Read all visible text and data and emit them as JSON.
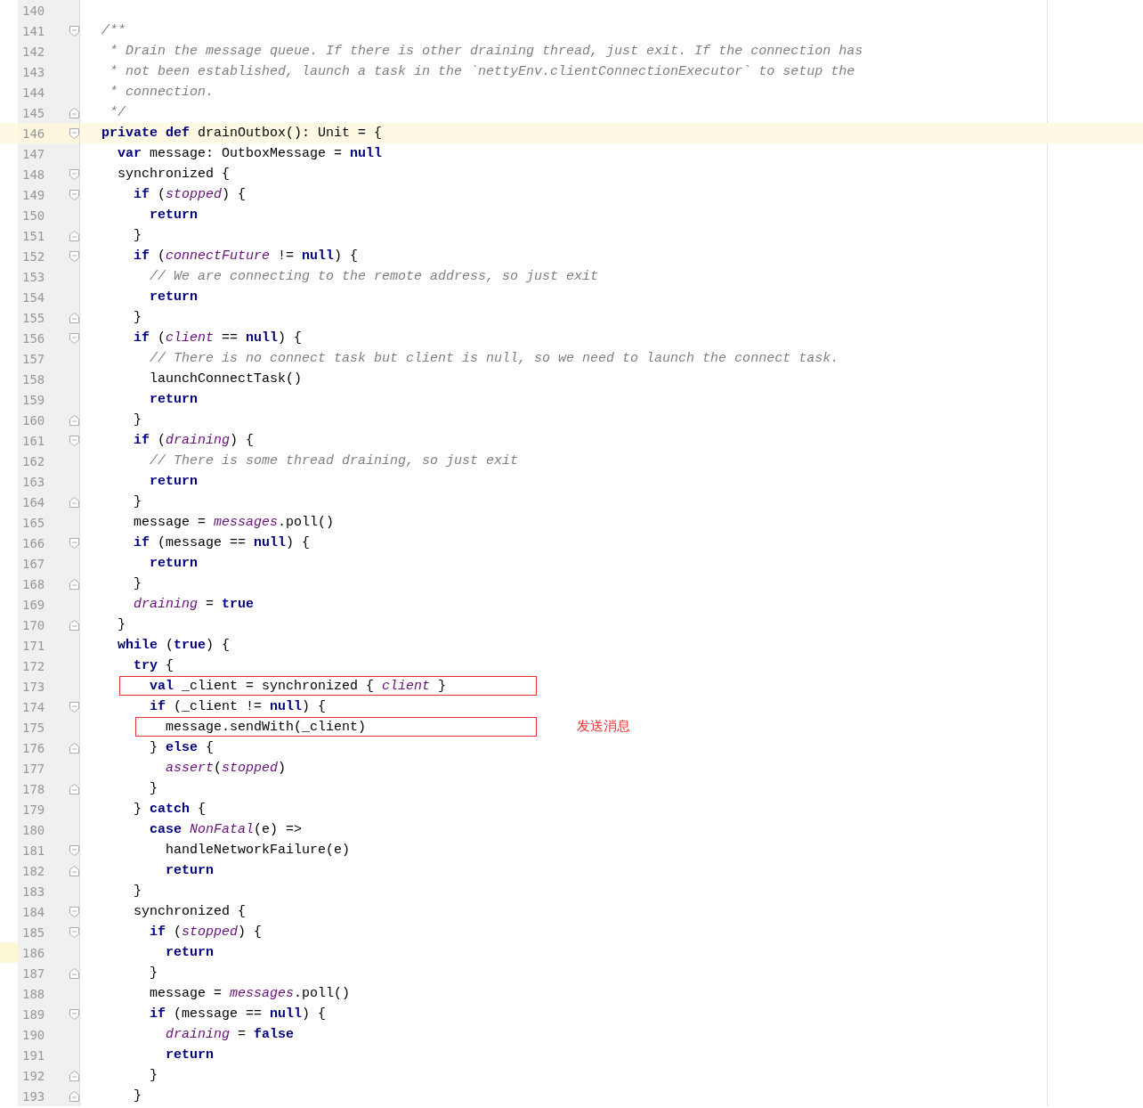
{
  "lines": [
    {
      "number": "140"
    },
    {
      "number": "141",
      "kind": "comment",
      "fold_start": true,
      "text": "/**"
    },
    {
      "number": "142",
      "kind": "comment",
      "text": " * Drain the message queue. If there is other draining thread, just exit. If the connection has"
    },
    {
      "number": "143",
      "kind": "comment",
      "text": " * not been established, launch a task in the `nettyEnv.clientConnectionExecutor` to setup the"
    },
    {
      "number": "144",
      "kind": "comment",
      "text": " * connection."
    },
    {
      "number": "145",
      "kind": "comment",
      "fold_end": true,
      "text": " */"
    },
    {
      "number": "146",
      "kind": "code",
      "fold_start": true,
      "text": "**private def** drainOutbox(): Unit = {",
      "current": true
    },
    {
      "number": "147",
      "kind": "code",
      "text": "  **var** message: OutboxMessage = **null**"
    },
    {
      "number": "148",
      "kind": "code",
      "fold_start": true,
      "text": "  synchronized {"
    },
    {
      "number": "149",
      "kind": "code",
      "fold_start": true,
      "text": "    **if** (*stopped*) {"
    },
    {
      "number": "150",
      "kind": "code",
      "text": "      **return**"
    },
    {
      "number": "151",
      "kind": "code",
      "fold_end": true,
      "text": "    }"
    },
    {
      "number": "152",
      "kind": "code",
      "fold_start": true,
      "text": "    **if** (*connectFuture* != **null**) {"
    },
    {
      "number": "153",
      "kind": "comment",
      "text": "      // We are connecting to the remote address, so just exit"
    },
    {
      "number": "154",
      "kind": "code",
      "text": "      **return**"
    },
    {
      "number": "155",
      "kind": "code",
      "fold_end": true,
      "text": "    }"
    },
    {
      "number": "156",
      "kind": "code",
      "fold_start": true,
      "text": "    **if** (*client* == **null**) {"
    },
    {
      "number": "157",
      "kind": "comment",
      "text": "      // There is no connect task but client is null, so we need to launch the connect task."
    },
    {
      "number": "158",
      "kind": "code",
      "text": "      launchConnectTask()"
    },
    {
      "number": "159",
      "kind": "code",
      "text": "      **return**"
    },
    {
      "number": "160",
      "kind": "code",
      "fold_end": true,
      "text": "    }"
    },
    {
      "number": "161",
      "kind": "code",
      "fold_start": true,
      "text": "    **if** (*draining*) {"
    },
    {
      "number": "162",
      "kind": "comment",
      "text": "      // There is some thread draining, so just exit"
    },
    {
      "number": "163",
      "kind": "code",
      "text": "      **return**"
    },
    {
      "number": "164",
      "kind": "code",
      "fold_end": true,
      "text": "    }"
    },
    {
      "number": "165",
      "kind": "code",
      "text": "    message = *messages*.poll()"
    },
    {
      "number": "166",
      "kind": "code",
      "fold_start": true,
      "text": "    **if** (message == **null**) {"
    },
    {
      "number": "167",
      "kind": "code",
      "text": "      **return**"
    },
    {
      "number": "168",
      "kind": "code",
      "fold_end": true,
      "text": "    }"
    },
    {
      "number": "169",
      "kind": "code",
      "text": "    *draining* = **true**"
    },
    {
      "number": "170",
      "kind": "code",
      "fold_end": true,
      "text": "  }"
    },
    {
      "number": "171",
      "kind": "code",
      "text": "  **while** (**true**) {"
    },
    {
      "number": "172",
      "kind": "code",
      "text": "    **try** {"
    },
    {
      "number": "173",
      "kind": "code",
      "text": "      **val** _client = synchronized { *client* }",
      "boxed": true
    },
    {
      "number": "174",
      "kind": "code",
      "fold_start": true,
      "text": "      **if** (_client != **null**) {"
    },
    {
      "number": "175",
      "kind": "code",
      "text": "        message.sendWith(_client)",
      "boxed": true,
      "note": "发送消息"
    },
    {
      "number": "176",
      "kind": "code",
      "fold_end": true,
      "text": "      } **else** {"
    },
    {
      "number": "177",
      "kind": "code",
      "text": "        *assert*(*stopped*)"
    },
    {
      "number": "178",
      "kind": "code",
      "fold_end": true,
      "text": "      }"
    },
    {
      "number": "179",
      "kind": "code",
      "text": "    } **catch** {"
    },
    {
      "number": "180",
      "kind": "code",
      "text": "      **case** *NonFatal*(e) =>"
    },
    {
      "number": "181",
      "kind": "code",
      "fold_start": true,
      "text": "        handleNetworkFailure(e)"
    },
    {
      "number": "182",
      "kind": "code",
      "fold_end": true,
      "text": "        **return**"
    },
    {
      "number": "183",
      "kind": "code",
      "text": "    }"
    },
    {
      "number": "184",
      "kind": "code",
      "fold_start": true,
      "text": "    synchronized {"
    },
    {
      "number": "185",
      "kind": "code",
      "fold_start": true,
      "text": "      **if** (*stopped*) {"
    },
    {
      "number": "186",
      "kind": "code",
      "text": "        **return**",
      "marked": true
    },
    {
      "number": "187",
      "kind": "code",
      "fold_end": true,
      "text": "      }"
    },
    {
      "number": "188",
      "kind": "code",
      "text": "      message = *messages*.poll()"
    },
    {
      "number": "189",
      "kind": "code",
      "fold_start": true,
      "text": "      **if** (message == **null**) {"
    },
    {
      "number": "190",
      "kind": "code",
      "text": "        *draining* = **false**"
    },
    {
      "number": "191",
      "kind": "code",
      "text": "        **return**"
    },
    {
      "number": "192",
      "kind": "code",
      "fold_end": true,
      "text": "      }"
    },
    {
      "number": "193",
      "kind": "code",
      "fold_end": true,
      "text": "    }"
    }
  ]
}
